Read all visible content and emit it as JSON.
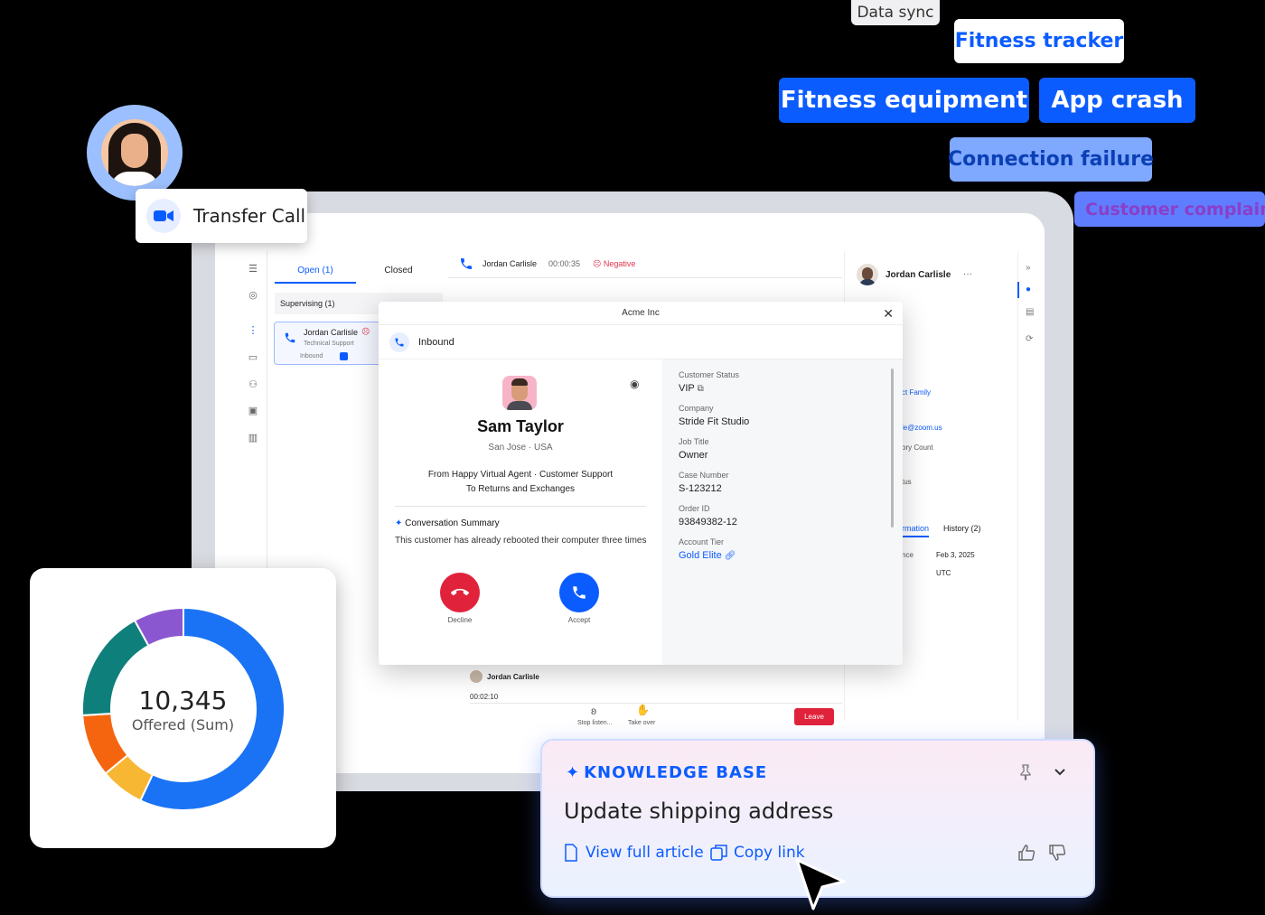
{
  "tags": {
    "data_sync": "Data sync",
    "fitness_tracker": "Fitness tracker",
    "fitness_equipment": "Fitness equipment",
    "app_crash": "App crash",
    "connection_failure": "Connection failure",
    "customer_complaint": "Customer complaint"
  },
  "transfer": {
    "label": "Transfer Call",
    "icon": "video-camera-icon"
  },
  "queue": {
    "tab_open": "Open (1)",
    "tab_closed": "Closed",
    "supervising": "Supervising (1)",
    "card": {
      "name": "Jordan Carlisle",
      "dept": "Technical Support",
      "direction": "Inbound"
    }
  },
  "active_call": {
    "name": "Jordan Carlisle",
    "duration": "00:00:35",
    "sentiment": "Negative"
  },
  "customer_panel": {
    "name": "Jordan Carlisle",
    "fragments": [
      "ct Family",
      "le@zoom.us",
      "ory Count",
      "tus",
      "rmation",
      "History (2)",
      "nce",
      "Feb 3, 2025",
      "UTC"
    ]
  },
  "modal": {
    "title": "Acme Inc",
    "direction": "Inbound",
    "caller": {
      "name": "Sam Taylor",
      "location": "San Jose  · USA",
      "route_line1": "From Happy Virtual Agent · Customer Support",
      "route_line2": "To Returns and Exchanges"
    },
    "summary_title": "Conversation Summary",
    "summary_text": "This customer has already rebooted their computer three times",
    "decline": "Decline",
    "accept": "Accept",
    "fields": [
      {
        "label": "Customer Status",
        "value": "VIP"
      },
      {
        "label": "Company",
        "value": "Stride Fit Studio"
      },
      {
        "label": "Job Title",
        "value": "Owner"
      },
      {
        "label": "Case Number",
        "value": "S-123212"
      },
      {
        "label": "Order ID",
        "value": "93849382-12"
      },
      {
        "label": "Account Tier",
        "value": "Gold Elite"
      }
    ]
  },
  "monitor": {
    "name": "Jordan Carlisle",
    "time": "00:02:10",
    "stop": "Stop listen...",
    "take": "Take over",
    "leave": "Leave"
  },
  "donut": {
    "value": "10,345",
    "label": "Offered (Sum)"
  },
  "chart_data": {
    "type": "pie",
    "title": "",
    "series": [
      {
        "color": "#1a73f5",
        "value": 0.57
      },
      {
        "color": "#f7b733",
        "value": 0.07
      },
      {
        "color": "#f5650f",
        "value": 0.1
      },
      {
        "color": "#0f7f7b",
        "value": 0.18
      },
      {
        "color": "#8a57d1",
        "value": 0.08
      }
    ]
  },
  "kb": {
    "title": "KNOWLEDGE BASE",
    "heading": "Update shipping address",
    "view_article": "View full article",
    "copy_link": "Copy link"
  },
  "colors": {
    "brand": "#0b5cff",
    "danger": "#e0233b"
  }
}
